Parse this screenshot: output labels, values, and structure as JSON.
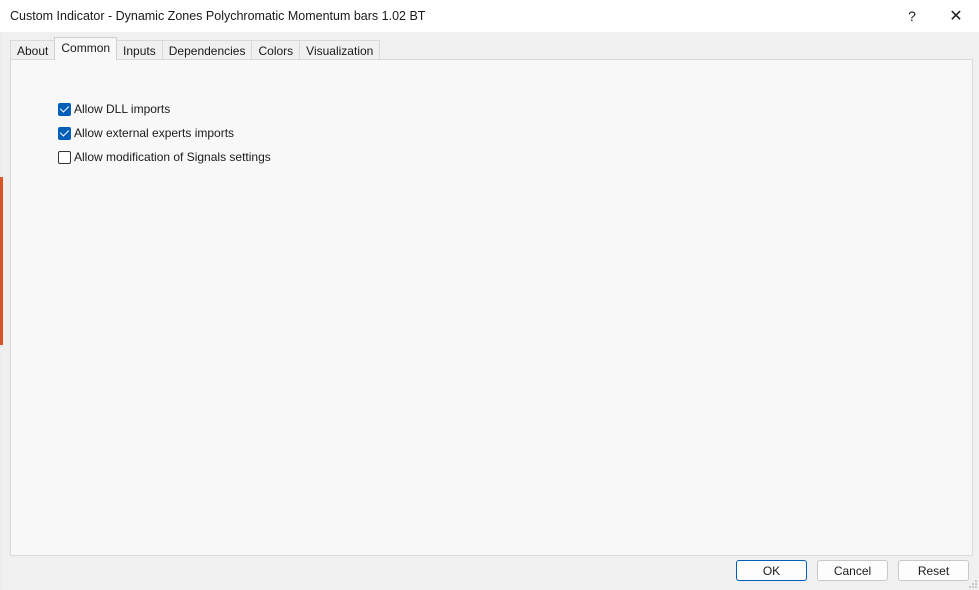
{
  "window": {
    "title": "Custom Indicator - Dynamic Zones Polychromatic Momentum bars 1.02 BT",
    "help_glyph": "?",
    "close_glyph": "✕"
  },
  "tabs": [
    {
      "label": "About",
      "active": false
    },
    {
      "label": "Common",
      "active": true
    },
    {
      "label": "Inputs",
      "active": false
    },
    {
      "label": "Dependencies",
      "active": false
    },
    {
      "label": "Colors",
      "active": false
    },
    {
      "label": "Visualization",
      "active": false
    }
  ],
  "options": [
    {
      "label": "Allow DLL imports",
      "checked": true
    },
    {
      "label": "Allow external experts imports",
      "checked": true
    },
    {
      "label": "Allow modification of Signals settings",
      "checked": false
    }
  ],
  "buttons": {
    "ok": "OK",
    "cancel": "Cancel",
    "reset": "Reset"
  },
  "colors": {
    "accent": "#005fb8",
    "side_strip": "#d9542b"
  }
}
